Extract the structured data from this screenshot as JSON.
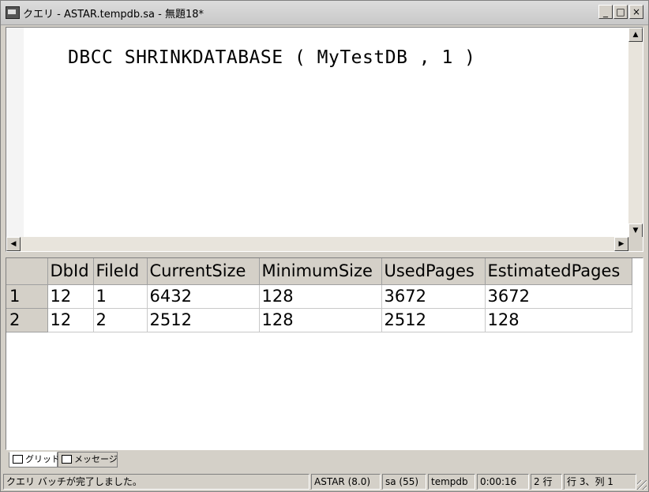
{
  "window": {
    "title": "クエリ - ASTAR.tempdb.sa - 無題18*",
    "minimize": "_",
    "maximize": "□",
    "close": "×"
  },
  "editor": {
    "code": "DBCC SHRINKDATABASE ( MyTestDB , 1 )"
  },
  "results": {
    "columns": [
      "DbId",
      "FileId",
      "CurrentSize",
      "MinimumSize",
      "UsedPages",
      "EstimatedPages"
    ],
    "rows": [
      {
        "num": "1",
        "cells": [
          "12",
          "1",
          "6432",
          "128",
          "3672",
          "3672"
        ]
      },
      {
        "num": "2",
        "cells": [
          "12",
          "2",
          "2512",
          "128",
          "2512",
          "128"
        ]
      }
    ]
  },
  "tabs": [
    {
      "label": "グリッド",
      "icon": "grid-icon"
    },
    {
      "label": "メッセージ",
      "icon": "messages-icon"
    }
  ],
  "status": {
    "message": "クエリ バッチが完了しました。",
    "server": "ASTAR (8.0)",
    "user": "sa (55)",
    "database": "tempdb",
    "elapsed": "0:00:16",
    "rows": "2 行",
    "position": "行 3、列 1"
  }
}
